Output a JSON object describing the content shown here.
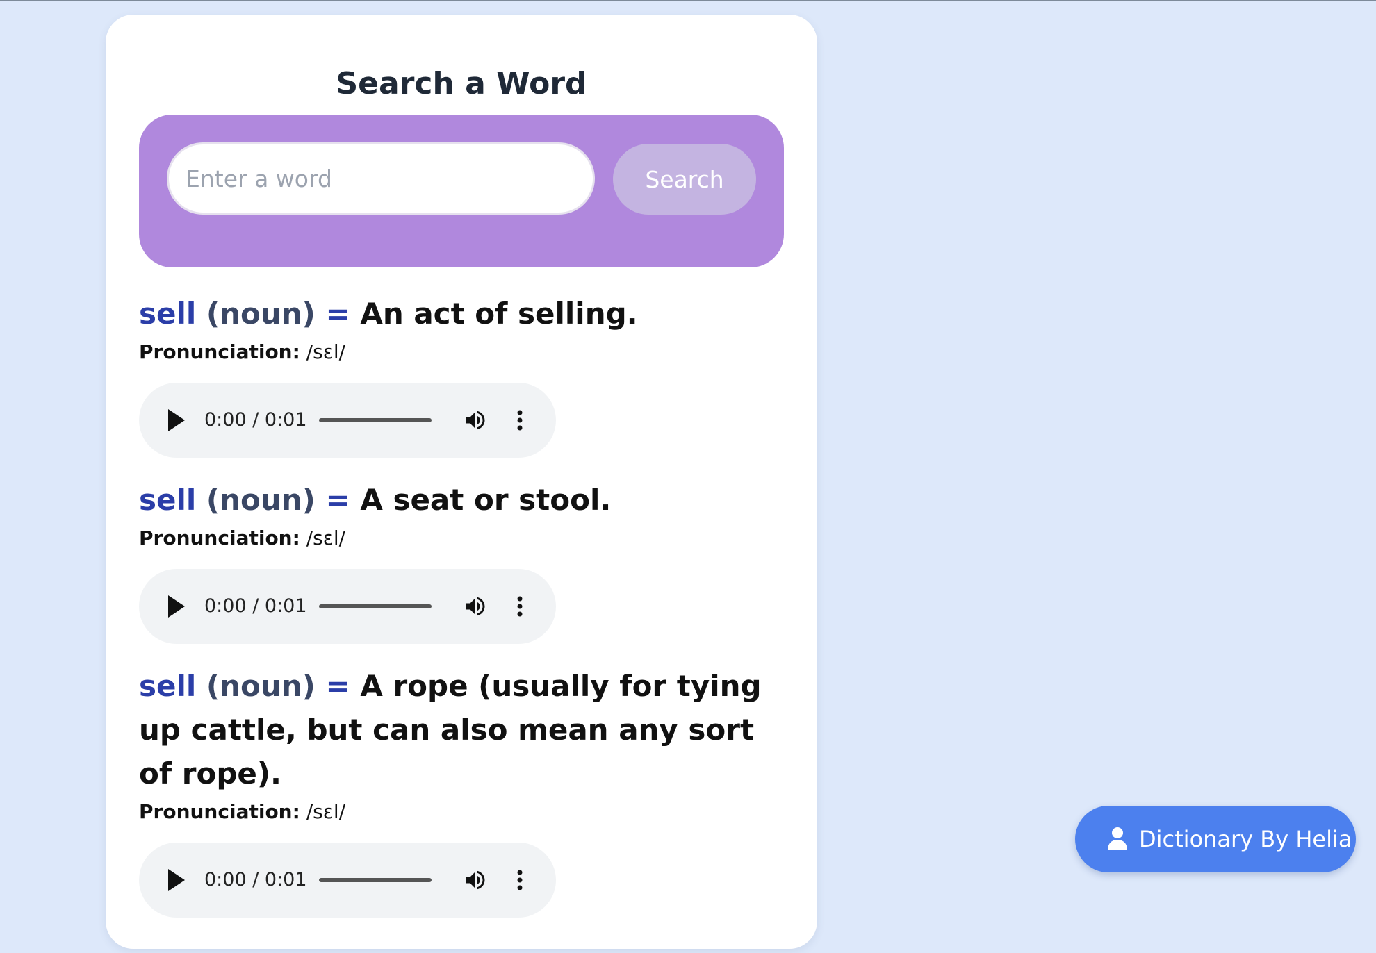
{
  "header": {
    "title": "Search a Word"
  },
  "search": {
    "placeholder": "Enter a word",
    "value": "",
    "button_label": "Search"
  },
  "results": [
    {
      "word": "sell",
      "pos": "(noun)",
      "separator": "=",
      "definition": "An act of selling.",
      "pronunciation_label": "Pronunciation:",
      "pronunciation": "/sɛl/",
      "audio": {
        "time": "0:00 / 0:01"
      }
    },
    {
      "word": "sell",
      "pos": "(noun)",
      "separator": "=",
      "definition": "A seat or stool.",
      "pronunciation_label": "Pronunciation:",
      "pronunciation": "/sɛl/",
      "audio": {
        "time": "0:00 / 0:01"
      }
    },
    {
      "word": "sell",
      "pos": "(noun)",
      "separator": "=",
      "definition": "A rope (usually for tying up cattle, but can also mean any sort of rope).",
      "pronunciation_label": "Pronunciation:",
      "pronunciation": "/sɛl/",
      "audio": {
        "time": "0:00 / 0:01"
      }
    }
  ],
  "icons": {
    "play": "play-icon",
    "volume": "volume-icon",
    "more": "more-vertical-icon",
    "person": "person-icon"
  },
  "badge": {
    "label": "Dictionary By Helia"
  },
  "colors": {
    "background": "#dde8fa",
    "search_panel": "#b088dd",
    "search_button": "#c4b4e1",
    "word": "#2b3ea8",
    "badge": "#4c80ee"
  }
}
